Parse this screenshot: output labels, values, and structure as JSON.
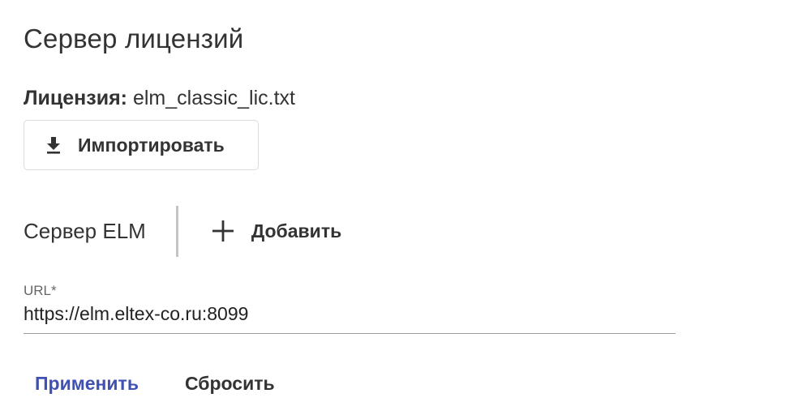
{
  "page": {
    "title": "Сервер лицензий"
  },
  "license": {
    "label": "Лицензия:",
    "file_name": "elm_classic_lic.txt",
    "import_label": "Импортировать",
    "import_icon": "download-icon"
  },
  "server": {
    "title": "Сервер ELM",
    "add_label": "Добавить",
    "add_icon": "plus-icon"
  },
  "url_field": {
    "label": "URL*",
    "value": "https://elm.eltex-co.ru:8099"
  },
  "actions": {
    "apply_label": "Применить",
    "reset_label": "Сбросить"
  },
  "colors": {
    "primary": "#3f51b5",
    "text": "#333333",
    "divider": "#c4c4c4"
  }
}
